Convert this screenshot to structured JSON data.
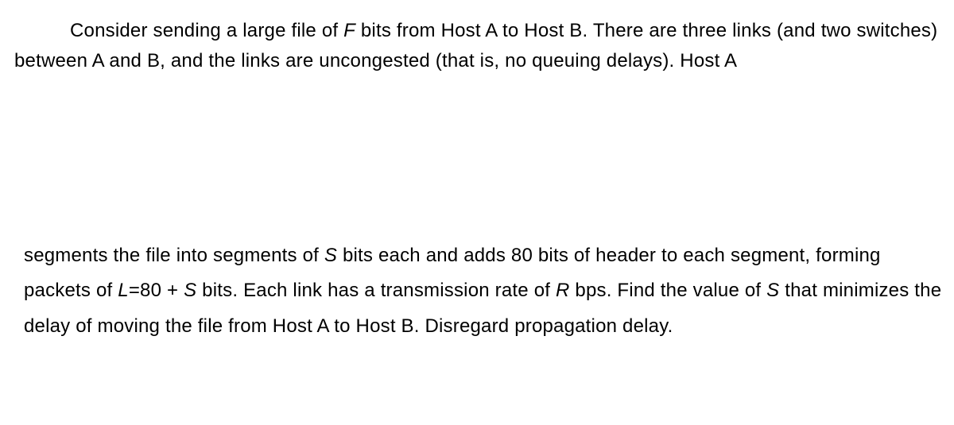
{
  "paragraph1": {
    "part1": "Consider sending a large file of ",
    "var1": "F",
    "part2": " bits from Host A to Host B. There are three links (and two switches) between A and B, and the links are uncongested (that is, no queuing delays). Host A"
  },
  "paragraph2": {
    "part1": "segments the file into segments of ",
    "var1": "S",
    "part2": " bits each and adds 80 bits of header to each segment, forming packets of ",
    "var2": "L",
    "part3": "=80 + ",
    "var3": "S",
    "part4": " bits. Each link has a transmission rate of ",
    "var4": "R",
    "part5": " bps. Find the value of ",
    "var5": "S",
    "part6": " that minimizes the delay of moving the file from Host A to Host B. Disregard propagation delay."
  }
}
